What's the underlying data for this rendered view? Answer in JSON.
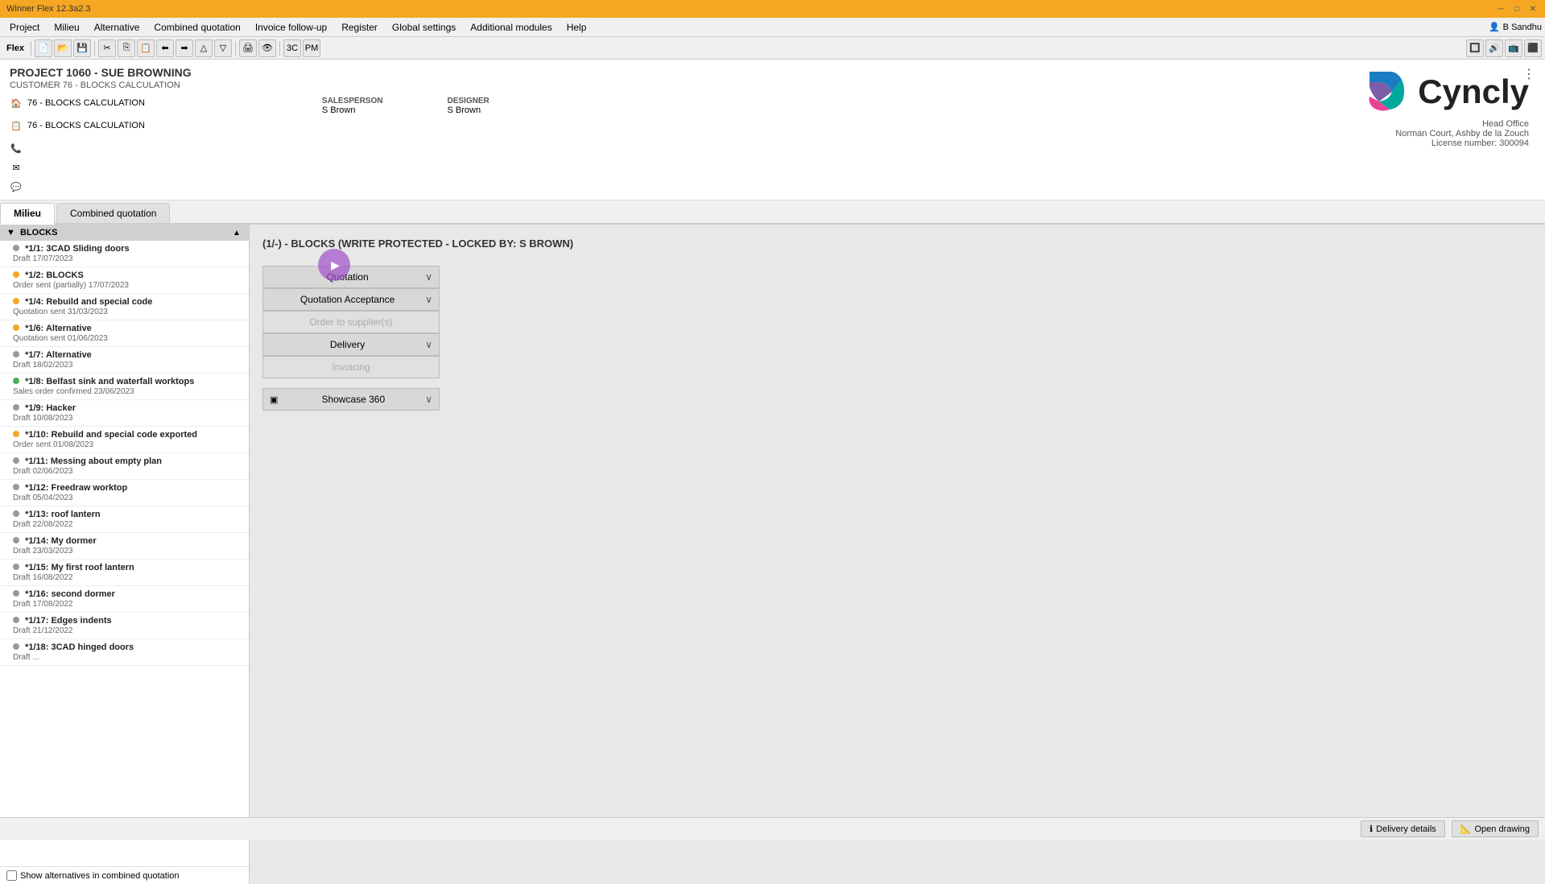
{
  "titlebar": {
    "title": "Winner Flex 12.3a2.3",
    "controls": [
      "─",
      "□",
      "✕"
    ]
  },
  "menubar": {
    "items": [
      "Project",
      "Milieu",
      "Alternative",
      "Combined quotation",
      "Invoice follow-up",
      "Register",
      "Global settings",
      "Additional modules",
      "Help"
    ]
  },
  "toolbar": {
    "label": "Flex",
    "buttons": [
      "new",
      "open",
      "save",
      "sep",
      "cut",
      "copy",
      "paste",
      "sep",
      "print",
      "preview",
      "sep",
      "code1",
      "code2"
    ]
  },
  "user": {
    "icon": "👤",
    "name": "B Sandhu"
  },
  "project": {
    "title": "PROJECT 1060 - SUE BROWNING",
    "subtitle": "CUSTOMER 76 - BLOCKS CALCULATION",
    "milieu_label": "76 - BLOCKS CALCULATION",
    "milieu_icon": "🏠",
    "drawing_label": "76 - BLOCKS CALCULATION",
    "drawing_icon": "📋",
    "salesperson_label": "SALESPERSON",
    "salesperson_value": "S Brown",
    "designer_label": "DESIGNER",
    "designer_value": "S Brown"
  },
  "tabs": [
    {
      "label": "Milieu",
      "active": true
    },
    {
      "label": "Combined quotation",
      "active": false
    }
  ],
  "sidebar": {
    "header": "BLOCKS",
    "items": [
      {
        "title": "*1/1: 3CAD Sliding doors",
        "subtitle": "Draft 17/07/2023",
        "dot": "gray"
      },
      {
        "title": "*1/2: BLOCKS",
        "subtitle": "Order sent (partially) 17/07/2023",
        "dot": "orange"
      },
      {
        "title": "*1/4: Rebuild and special code",
        "subtitle": "Quotation sent 31/03/2023",
        "dot": "orange"
      },
      {
        "title": "*1/6: Alternative",
        "subtitle": "Quotation sent 01/06/2023",
        "dot": "orange"
      },
      {
        "title": "*1/7: Alternative",
        "subtitle": "Draft 18/02/2023",
        "dot": "gray"
      },
      {
        "title": "*1/8: Belfast sink and waterfall worktops",
        "subtitle": "Sales order confirmed 23/06/2023",
        "dot": "green"
      },
      {
        "title": "*1/9: Hacker",
        "subtitle": "Draft 10/08/2023",
        "dot": "gray"
      },
      {
        "title": "*1/10: Rebuild and special code exported",
        "subtitle": "Order sent 01/08/2023",
        "dot": "orange"
      },
      {
        "title": "*1/11: Messing about empty plan",
        "subtitle": "Draft 02/06/2023",
        "dot": "gray"
      },
      {
        "title": "*1/12: Freedraw worktop",
        "subtitle": "Draft 05/04/2023",
        "dot": "gray"
      },
      {
        "title": "*1/13: roof lantern",
        "subtitle": "Draft 22/08/2022",
        "dot": "gray"
      },
      {
        "title": "*1/14: My dormer",
        "subtitle": "Draft 23/03/2023",
        "dot": "gray"
      },
      {
        "title": "*1/15: My first roof lantern",
        "subtitle": "Draft 16/08/2022",
        "dot": "gray"
      },
      {
        "title": "*1/16: second dormer",
        "subtitle": "Draft 17/08/2022",
        "dot": "gray"
      },
      {
        "title": "*1/17: Edges indents",
        "subtitle": "Draft 21/12/2022",
        "dot": "gray"
      },
      {
        "title": "*1/18: 3CAD hinged doors",
        "subtitle": "Draft ...",
        "dot": "gray"
      }
    ]
  },
  "content": {
    "title": "(1/-) - BLOCKS (WRITE PROTECTED - LOCKED BY: S BROWN)",
    "workflow": [
      {
        "label": "Quotation",
        "chevron": true,
        "disabled": false
      },
      {
        "label": "Quotation Acceptance",
        "chevron": true,
        "disabled": false
      },
      {
        "label": "Order to supplier(s)",
        "chevron": false,
        "disabled": true
      },
      {
        "label": "Delivery",
        "chevron": true,
        "disabled": false
      },
      {
        "label": "Invoicing",
        "chevron": false,
        "disabled": true
      }
    ],
    "showcase": {
      "icon": "▣",
      "label": "Showcase 360",
      "chevron": true
    }
  },
  "logo": {
    "text": "Cyncly",
    "address_line1": "Head Office",
    "address_line2": "Norman Court,  Ashby de la Zouch",
    "license": "License number: 300094"
  },
  "bottom": {
    "delivery_details": "Delivery details",
    "open_drawing": "Open drawing",
    "info_icon": "ℹ",
    "status1": "",
    "status2": ""
  },
  "show_alternatives": {
    "label": "Show alternatives in combined quotation"
  }
}
